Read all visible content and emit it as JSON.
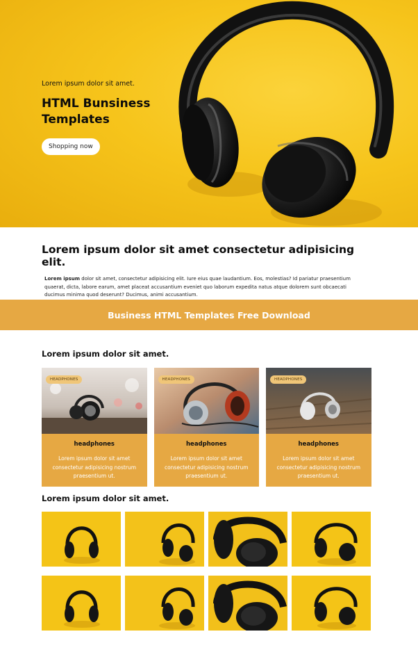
{
  "hero": {
    "kicker": "Lorem ipsum dolor sit amet.",
    "title_line1": "HTML Bunsiness",
    "title_line2": "Templates",
    "button_label": "Shopping now"
  },
  "intro": {
    "title": "Lorem ipsum dolor sit amet consectetur adipisicing elit.",
    "lead": "Lorem ipsum",
    "body": " dolor sit amet, consectetur adipisicing elit. Iure eius quae laudantium. Eos, molestias? Id pariatur praesentium quaerat, dicta, labore earum, amet placeat accusantium eveniet quo laborum expedita natus atque dolorem sunt obcaecati ducimus minima quod deserunt? Ducimus, animi accusantium."
  },
  "banner": {
    "text": "Business HTML Templates Free Download"
  },
  "cards_section": {
    "title": "Lorem ipsum dolor sit amet.",
    "cards": [
      {
        "tag": "HEADPHONES",
        "title": "headphones",
        "text": "Lorem ipsum dolor sit amet consectetur adipisicing nostrum praesentium ut."
      },
      {
        "tag": "HEADPHONES",
        "title": "headphones",
        "text": "Lorem ipsum dolor sit amet consectetur adipisicing nostrum praesentium ut."
      },
      {
        "tag": "HEADPHONES",
        "title": "headphones",
        "text": "Lorem ipsum dolor sit amet consectetur adipisicing nostrum praesentium ut."
      }
    ]
  },
  "gallery_section": {
    "title": "Lorem ipsum dolor sit amet."
  },
  "colors": {
    "hero_yellow": "#f6c41b",
    "accent_orange": "#e6a843"
  }
}
